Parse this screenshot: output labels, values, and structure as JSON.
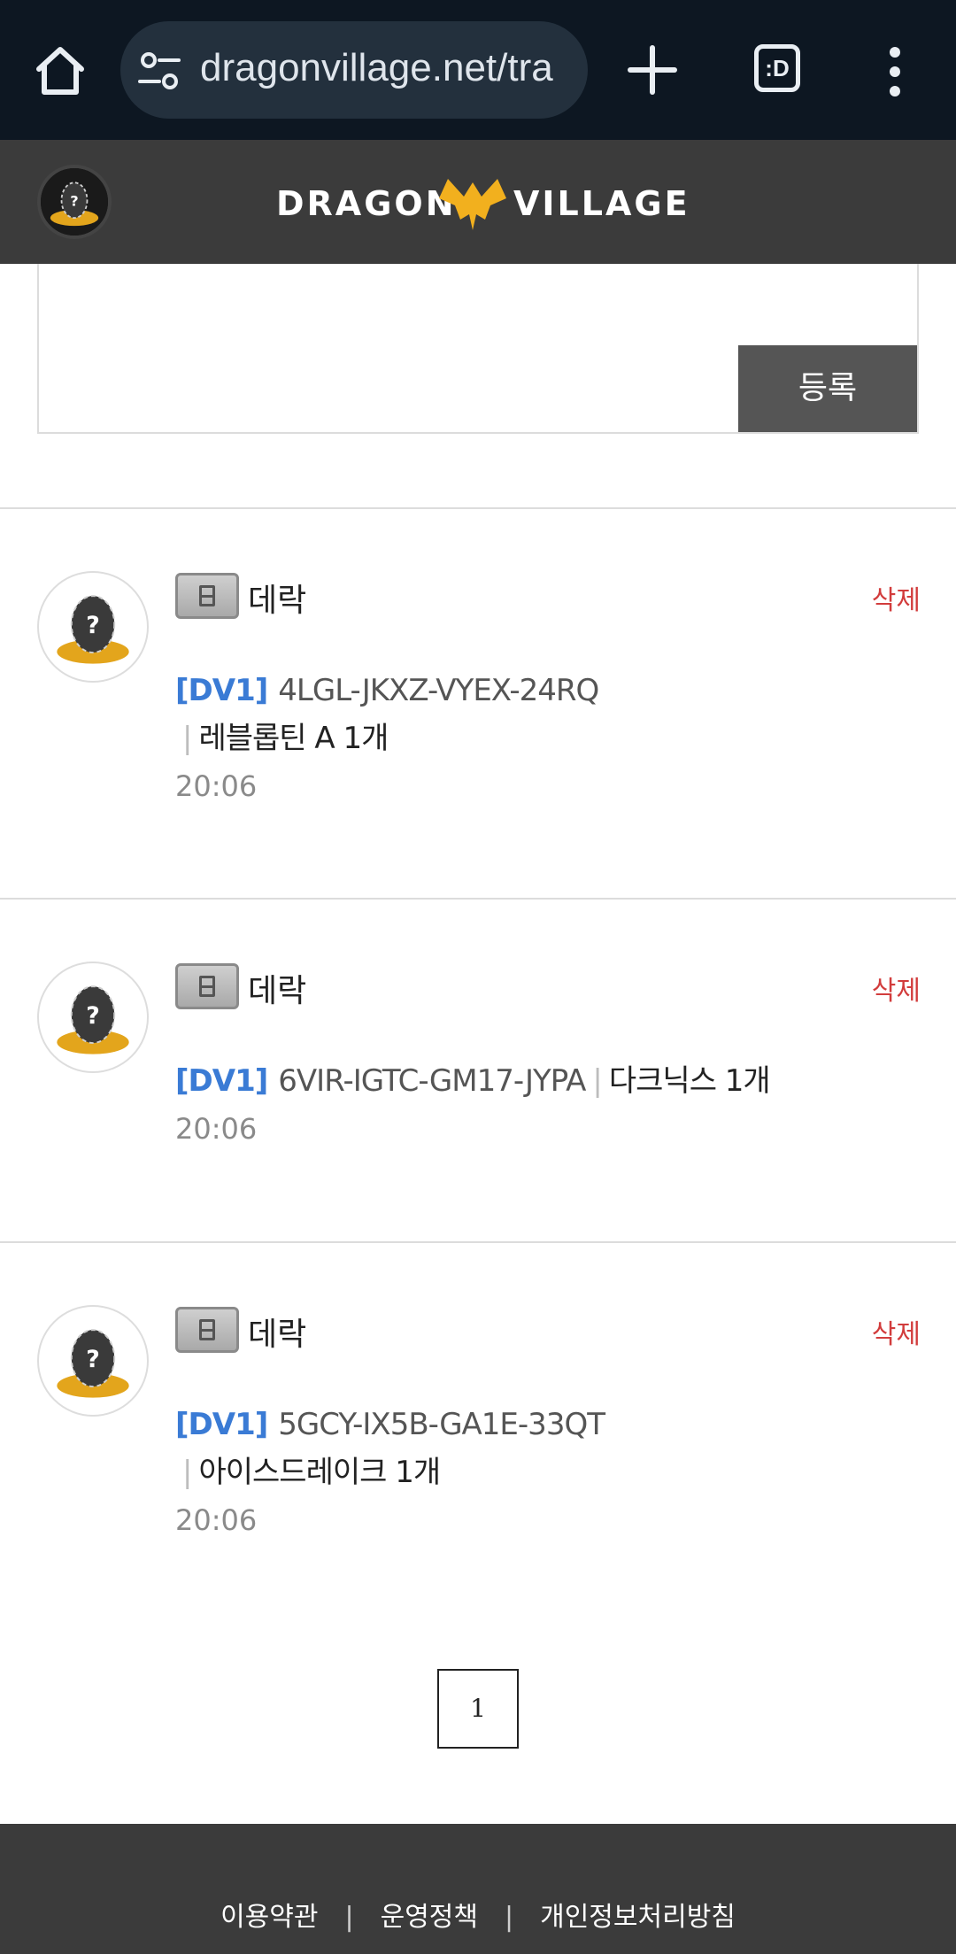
{
  "browser": {
    "url": "dragonvillage.net/tra",
    "tab_count": ":D"
  },
  "header": {
    "logo_left": "DRAGON",
    "logo_right": "VILLAGE"
  },
  "comment_form": {
    "submit_label": "등록"
  },
  "comments": [
    {
      "author": "데락",
      "delete_label": "삭제",
      "tag": "[DV1]",
      "code": "4LGL-JKXZ-VYEX-24RQ",
      "separator": "|",
      "item": "레블롭틴 A 1개",
      "time": "20:06"
    },
    {
      "author": "데락",
      "delete_label": "삭제",
      "tag": "[DV1]",
      "code": "6VIR-IGTC-GM17-JYPA",
      "separator": "|",
      "item": "다크닉스 1개",
      "time": "20:06"
    },
    {
      "author": "데락",
      "delete_label": "삭제",
      "tag": "[DV1]",
      "code": "5GCY-IX5B-GA1E-33QT",
      "separator": "|",
      "item": "아이스드레이크 1개",
      "time": "20:06"
    }
  ],
  "pagination": {
    "current_page": "1"
  },
  "footer": {
    "links": [
      "이용약관",
      "운영정책",
      "개인정보처리방침"
    ],
    "separator": "|"
  },
  "colors": {
    "browser_bar": "#0d1722",
    "site_header": "#3b3b3b",
    "tag_blue": "#3a7bd5",
    "delete_red": "#d23c3c",
    "logo_gold": "#f2b01e"
  }
}
